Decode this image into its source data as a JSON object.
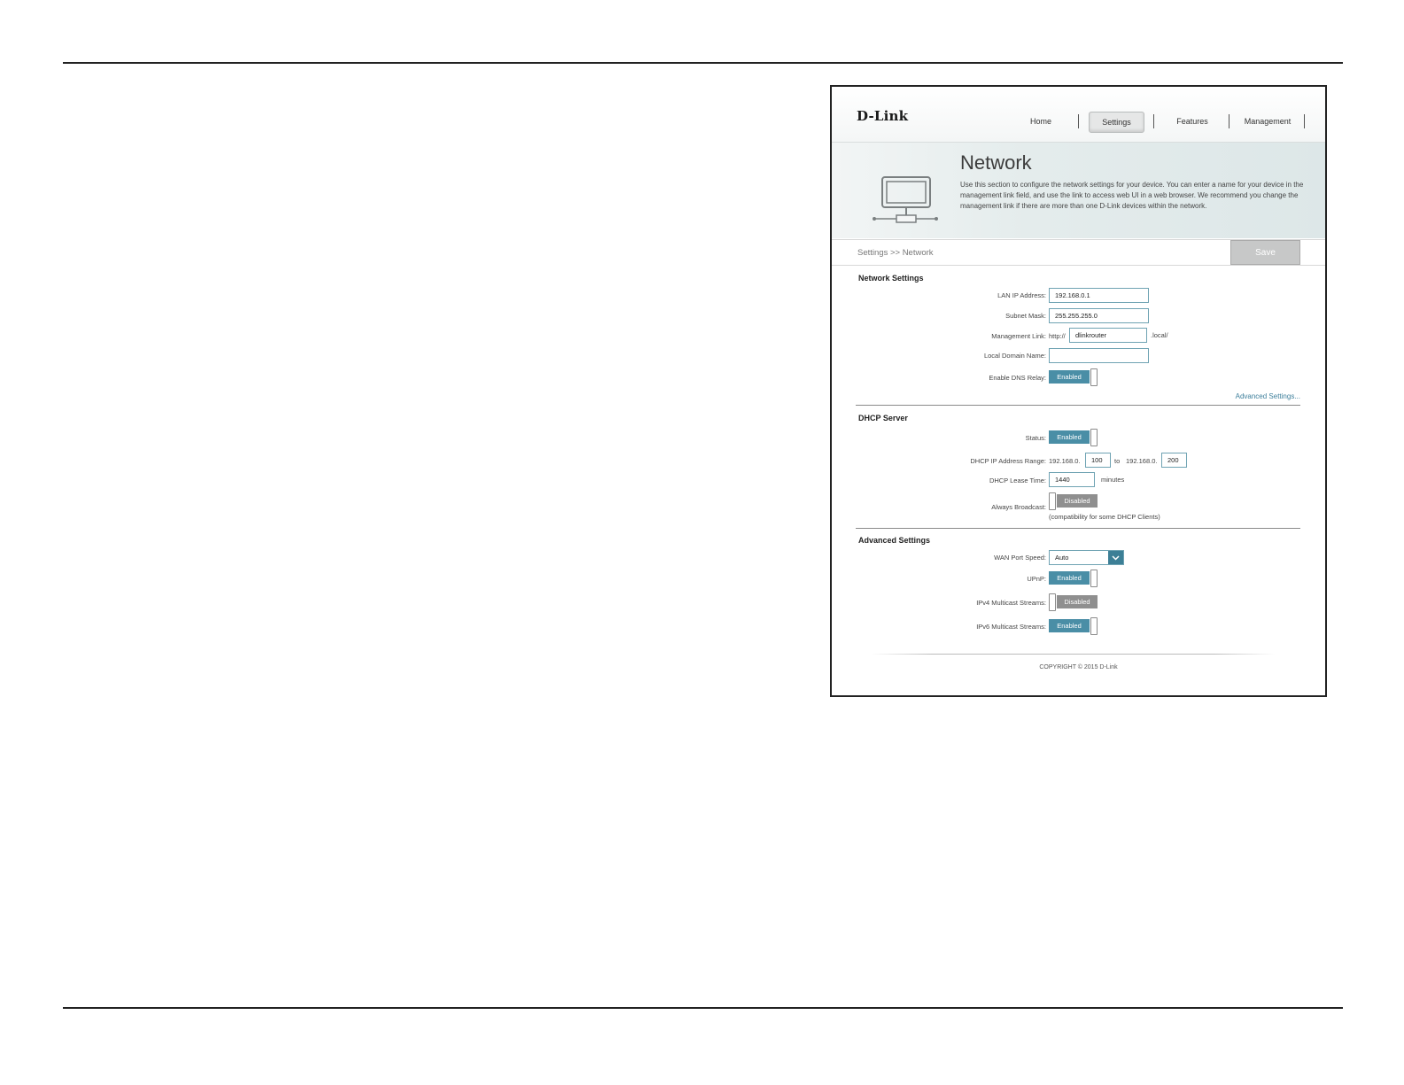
{
  "header": {
    "logo": "D-Link",
    "nav": [
      "Home",
      "Settings",
      "Features",
      "Management"
    ],
    "active_nav": "Settings"
  },
  "banner": {
    "title": "Network",
    "description": "Use this section to configure the network settings for your device. You can enter a name for your device in the management link field, and use the link to access web UI in a web browser. We recommend you change the management link if there are more than one D-Link devices within the network."
  },
  "breadcrumb": "Settings >> Network",
  "save_label": "Save",
  "network_settings": {
    "title": "Network Settings",
    "lan_ip_label": "LAN IP Address:",
    "lan_ip_value": "192.168.0.1",
    "subnet_label": "Subnet Mask:",
    "subnet_value": "255.255.255.0",
    "mgmt_label": "Management Link:",
    "mgmt_prefix": "http://",
    "mgmt_value": "dlinkrouter",
    "mgmt_suffix": ".local/",
    "domain_label": "Local Domain Name:",
    "domain_value": "",
    "dns_relay_label": "Enable DNS Relay:",
    "dns_relay_state": "Enabled",
    "advanced_link": "Advanced Settings..."
  },
  "dhcp": {
    "title": "DHCP Server",
    "status_label": "Status:",
    "status_state": "Enabled",
    "range_label": "DHCP IP Address Range:",
    "range_prefix": "192.168.0.",
    "range_start": "100",
    "range_to": "to",
    "range_prefix2": "192.168.0.",
    "range_end": "200",
    "lease_label": "DHCP Lease Time:",
    "lease_value": "1440",
    "lease_unit": "minutes",
    "broadcast_label": "Always Broadcast:",
    "broadcast_state": "Disabled",
    "broadcast_note": "(compatibility for some DHCP Clients)"
  },
  "advanced": {
    "title": "Advanced Settings",
    "wan_label": "WAN Port Speed:",
    "wan_value": "Auto",
    "upnp_label": "UPnP:",
    "upnp_state": "Enabled",
    "ipv4_label": "IPv4 Multicast Streams:",
    "ipv4_state": "Disabled",
    "ipv6_label": "IPv6 Multicast Streams:",
    "ipv6_state": "Enabled"
  },
  "footer": "COPYRIGHT © 2015 D-Link",
  "colors": {
    "accent": "#4a8ea6",
    "disabled": "#8f8f8f",
    "link": "#3d7f9b"
  }
}
